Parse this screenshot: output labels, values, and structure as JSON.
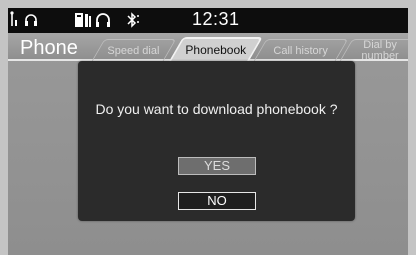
{
  "status_bar": {
    "time": "12:31",
    "icons": [
      "signal-icon",
      "headset-icon",
      "phone-battery-icon",
      "headset-connected-icon",
      "bluetooth-icon"
    ]
  },
  "header": {
    "title": "Phone",
    "tabs": [
      {
        "label": "Speed dial",
        "active": false
      },
      {
        "label": "Phonebook",
        "active": true
      },
      {
        "label": "Call history",
        "active": false
      },
      {
        "label_line1": "Dial by",
        "label_line2": "number",
        "active": false
      }
    ]
  },
  "dialog": {
    "message": "Do you want to download phonebook ?",
    "yes_label": "YES",
    "no_label": "NO"
  }
}
